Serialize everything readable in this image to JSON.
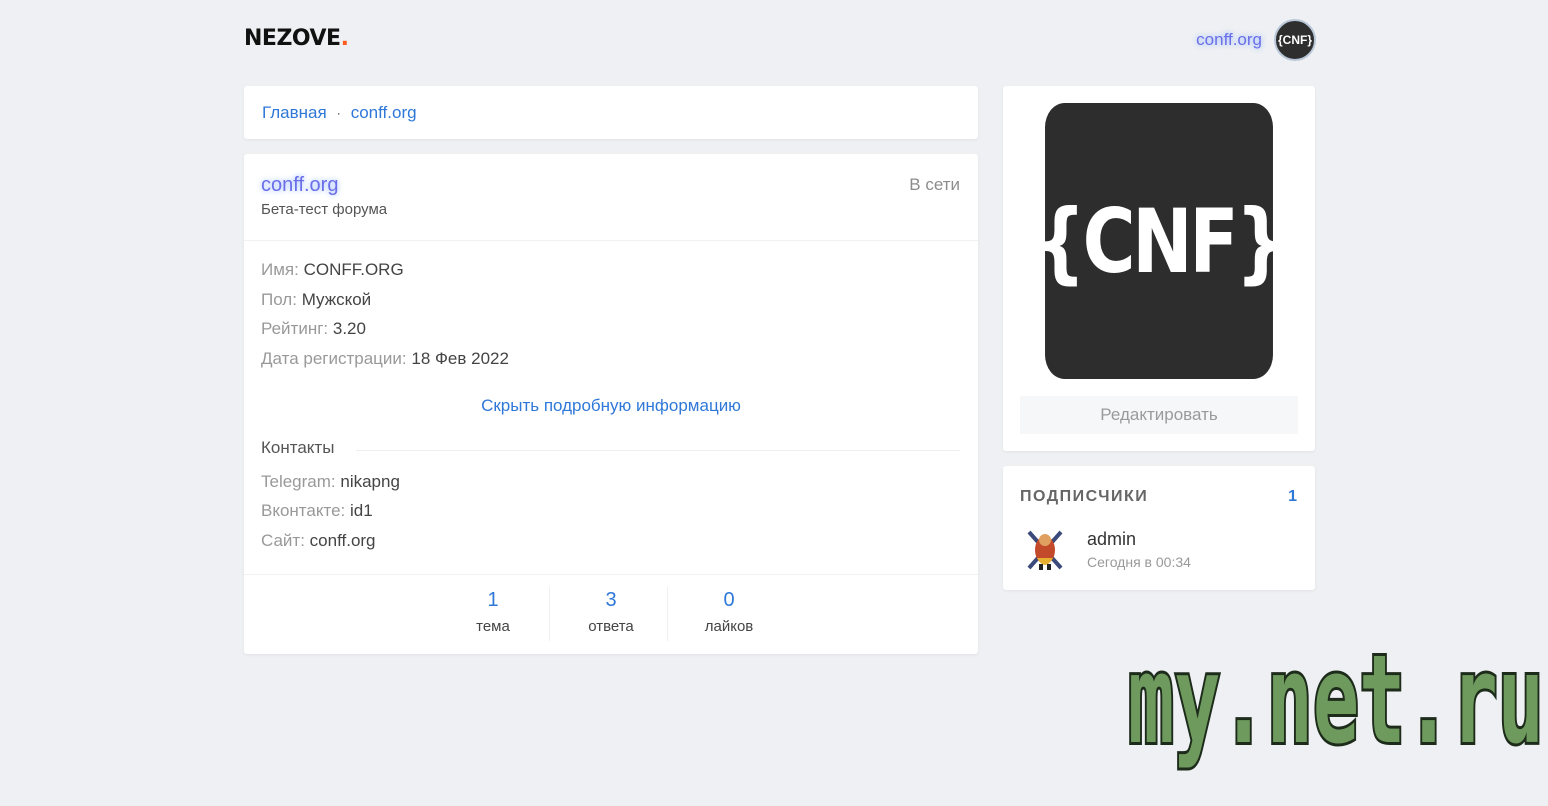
{
  "header": {
    "logo_text": "NEZOVE",
    "logo_dot": ".",
    "username": "conff.org",
    "avatar_text": "{CNF}"
  },
  "breadcrumb": {
    "home": "Главная",
    "separator": "·",
    "current": "conff.org"
  },
  "profile": {
    "name": "conff.org",
    "subtitle": "Бета-тест форума",
    "status": "В сети",
    "info": [
      {
        "label": "Имя:",
        "value": "CONFF.ORG"
      },
      {
        "label": "Пол:",
        "value": "Мужской"
      },
      {
        "label": "Рейтинг:",
        "value": "3.20"
      },
      {
        "label": "Дата регистрации:",
        "value": "18 Фев 2022"
      }
    ],
    "toggle_label": "Скрыть подробную информацию",
    "contacts_title": "Контакты",
    "contacts": [
      {
        "label": "Telegram:",
        "value": "nikapng"
      },
      {
        "label": "Вконтакте:",
        "value": "id1"
      },
      {
        "label": "Сайт:",
        "value": "conff.org"
      }
    ],
    "stats": [
      {
        "value": "1",
        "label": "тема"
      },
      {
        "value": "3",
        "label": "ответа"
      },
      {
        "value": "0",
        "label": "лайков"
      }
    ]
  },
  "sidebar": {
    "avatar_text": "{CNF}",
    "edit_label": "Редактировать",
    "subscribers_title": "ПОДПИСЧИКИ",
    "subscribers_count": "1",
    "subscribers": [
      {
        "name": "admin",
        "time": "Сегодня в 00:34"
      }
    ]
  },
  "watermark": {
    "text": "my.net.ru"
  },
  "colors": {
    "accent": "#2f78d8",
    "username_glow": "#6a6ee8",
    "logo_dot": "#ff5a1f",
    "watermark": "#6f9a5e"
  }
}
